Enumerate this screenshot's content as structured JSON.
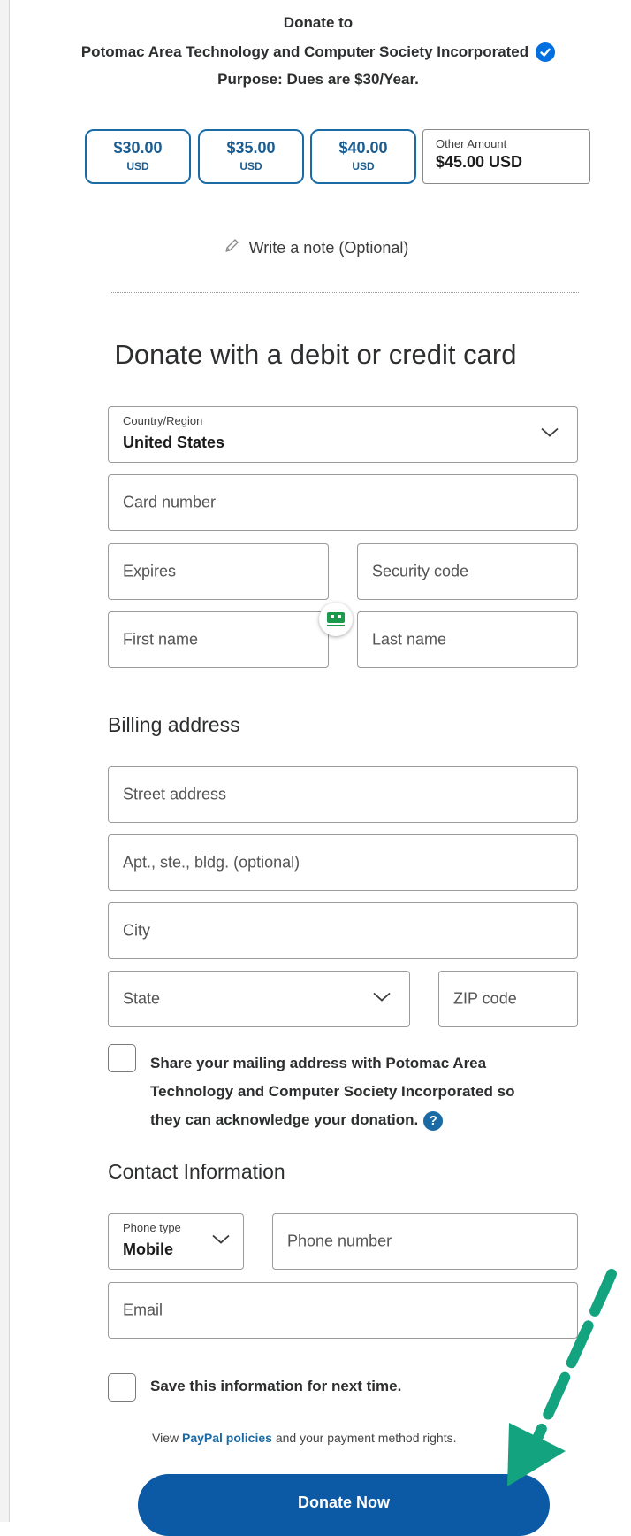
{
  "header": {
    "line1": "Donate to",
    "org_name": "Potomac Area Technology and Computer Society Incorporated",
    "purpose": "Purpose: Dues are $30/Year."
  },
  "amounts": [
    {
      "value": "$30.00",
      "currency": "USD"
    },
    {
      "value": "$35.00",
      "currency": "USD"
    },
    {
      "value": "$40.00",
      "currency": "USD"
    }
  ],
  "other_amount": {
    "label": "Other Amount",
    "value": "$45.00 USD"
  },
  "note_link": "Write a note (Optional)",
  "card_section": {
    "title": "Donate with a debit or credit card",
    "country_label": "Country/Region",
    "country_value": "United States",
    "card_number_placeholder": "Card number",
    "expires_placeholder": "Expires",
    "security_placeholder": "Security code",
    "first_name_placeholder": "First name",
    "last_name_placeholder": "Last name"
  },
  "billing": {
    "title": "Billing address",
    "street_placeholder": "Street address",
    "apt_placeholder": "Apt., ste., bldg. (optional)",
    "city_placeholder": "City",
    "state_placeholder": "State",
    "zip_placeholder": "ZIP code",
    "share_text_1": "Share your mailing address with Potomac Area",
    "share_text_2": "Technology and Computer Society Incorporated so",
    "share_text_3": "they can acknowledge your donation."
  },
  "contact": {
    "title": "Contact Information",
    "phone_type_label": "Phone type",
    "phone_type_value": "Mobile",
    "phone_placeholder": "Phone number",
    "email_placeholder": "Email",
    "save_info_label": "Save this information for next time."
  },
  "policies": {
    "prefix": "View",
    "link": "PayPal policies",
    "suffix": "and your payment method rights."
  },
  "donate_button": "Donate Now",
  "colors": {
    "accent_blue": "#0c5aa6",
    "amount_border": "#1a6aa5",
    "verified_blue": "#0070e0",
    "arrow_green": "#14a37f"
  },
  "icons": [
    "verified-badge-icon",
    "pencil-icon",
    "chevron-down-icon",
    "help-icon",
    "autofill-badge-icon",
    "annotation-arrow"
  ]
}
